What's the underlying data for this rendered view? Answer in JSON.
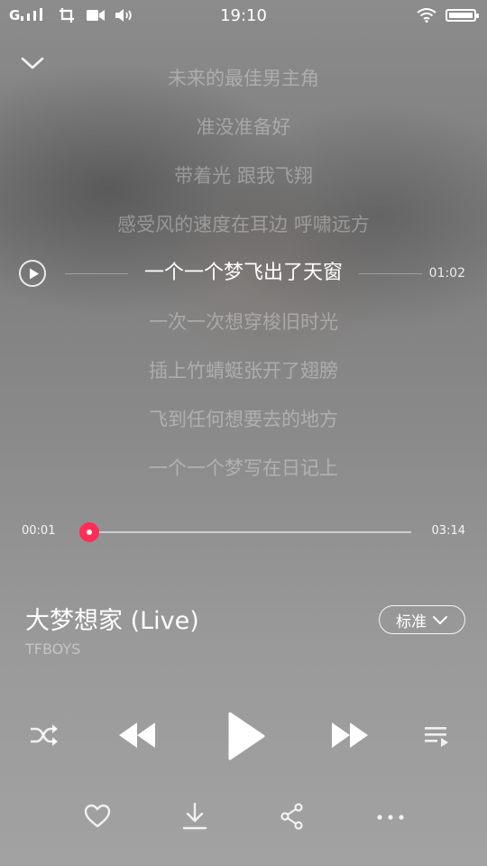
{
  "status_bar": {
    "carrier": "G",
    "time": "19:10"
  },
  "lyrics": {
    "lines": [
      "未来的最佳男主角",
      "准没准备好",
      "带着光 跟我飞翔",
      "感受风的速度在耳边 呼啸远方",
      "一个一个梦飞出了天窗",
      "一次一次想穿梭旧时光",
      "插上竹蜻蜓张开了翅膀",
      "飞到任何想要去的地方",
      "一个一个梦写在日记上"
    ],
    "current_index": 4,
    "current_time": "01:02"
  },
  "progress": {
    "elapsed": "00:01",
    "total": "03:14",
    "fraction": 0.005
  },
  "song": {
    "title": "大梦想家 (Live)",
    "artist": "TFBOYS"
  },
  "quality": {
    "label": "标准"
  },
  "colors": {
    "accent": "#ff2d55",
    "text": "#ffffff"
  },
  "icons": {
    "collapse": "chevron-down-icon",
    "shuffle": "shuffle-icon",
    "previous": "previous-icon",
    "play": "play-icon",
    "next": "next-icon",
    "playlist": "playlist-icon",
    "favorite": "heart-icon",
    "download": "download-icon",
    "share": "share-icon",
    "more": "more-icon"
  }
}
